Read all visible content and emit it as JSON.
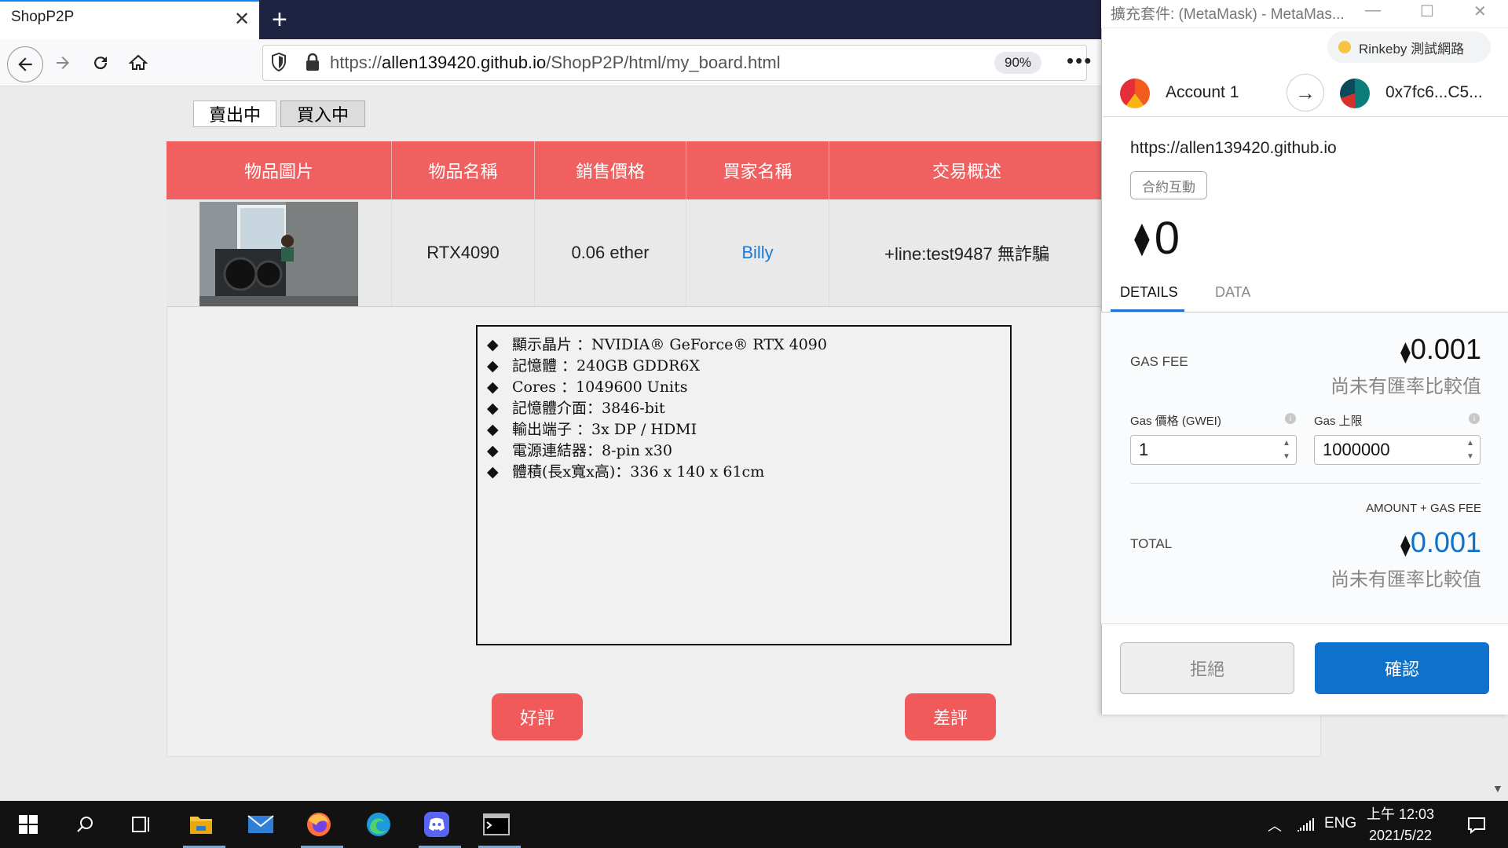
{
  "browser": {
    "tab_title": "ShopP2P",
    "tab_close": "✕",
    "new_tab": "+",
    "url_prefix": "https://",
    "url_domain": "allen139420.github.io",
    "url_path": "/ShopP2P/html/my_board.html",
    "zoom": "90%",
    "more": "•••"
  },
  "board": {
    "tabs": {
      "selling": "賣出中",
      "buying": "買入中"
    },
    "columns": [
      "物品圖片",
      "物品名稱",
      "銷售價格",
      "買家名稱",
      "交易概述"
    ],
    "row": {
      "name": "RTX4090",
      "price": "0.06 ether",
      "buyer": "Billy",
      "summary": "+line:test9487 無詐騙"
    },
    "description": [
      "顯示晶片 ：NVIDIA® GeForce® RTX 4090",
      "記憶體 ：240GB GDDR6X",
      "Cores ：1049600 Units",
      "記憶體介面：3846-bit",
      "輸出端子 ：3x DP / HDMI",
      "電源連結器：8-pin x30",
      "體積(長x寬x高)：336 x 140 x 61cm"
    ],
    "good_review": "好評",
    "bad_review": "差評"
  },
  "metamask": {
    "window_title": "擴充套件: (MetaMask) - MetaMas...",
    "network": "Rinkeby 測試網路",
    "account_name": "Account 1",
    "to_address": "0x7fc6...C5...",
    "origin": "https://allen139420.github.io",
    "contract_badge": "合約互動",
    "amount": "0",
    "tabs": {
      "details": "DETAILS",
      "data": "DATA"
    },
    "gas_fee_label": "GAS FEE",
    "gas_fee_value": "0.001",
    "no_rate": "尚未有匯率比較值",
    "gas_price_label": "Gas 價格 (GWEI)",
    "gas_limit_label": "Gas 上限",
    "gas_price_value": "1",
    "gas_limit_value": "1000000",
    "amount_plus_gas": "AMOUNT + GAS FEE",
    "total_label": "TOTAL",
    "total_value": "0.001",
    "reject": "拒絕",
    "confirm": "確認",
    "accent_color": "#0e72cc"
  },
  "taskbar": {
    "lang": "ENG",
    "time": "上午 12:03",
    "date": "2021/5/22"
  }
}
